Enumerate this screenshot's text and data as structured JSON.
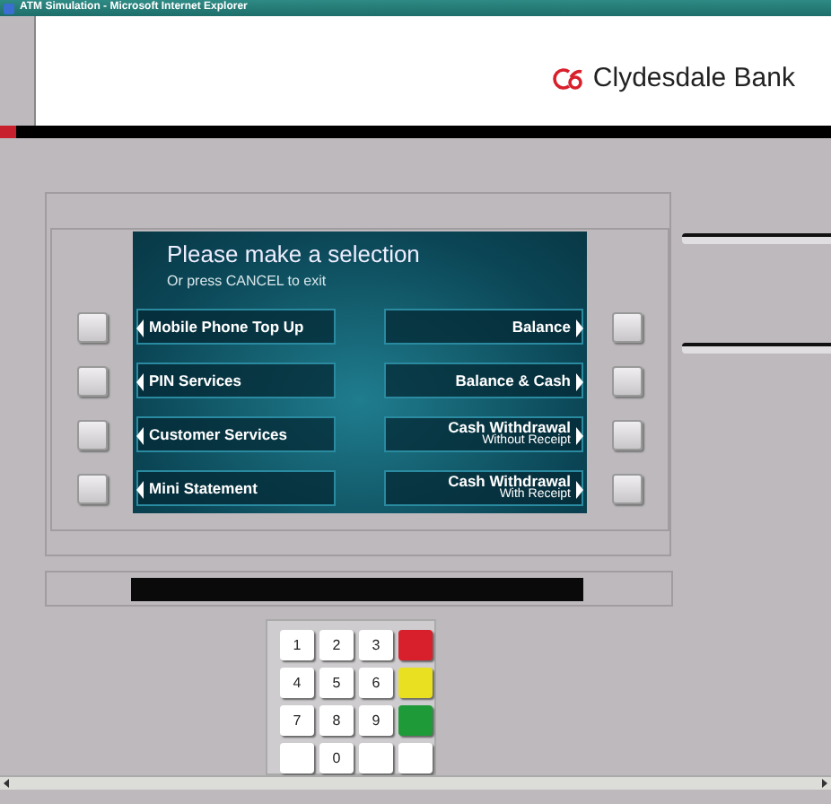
{
  "window": {
    "title": "ATM Simulation - Microsoft Internet Explorer"
  },
  "bank": {
    "name": "Clydesdale Bank"
  },
  "screen": {
    "heading": "Please make a selection",
    "subheading": "Or press CANCEL to exit",
    "left_options": [
      {
        "label": "Mobile Phone Top Up"
      },
      {
        "label": "PIN Services"
      },
      {
        "label": "Customer Services"
      },
      {
        "label": "Mini Statement"
      }
    ],
    "right_options": [
      {
        "label": "Balance"
      },
      {
        "label": "Balance & Cash"
      },
      {
        "label": "Cash Withdrawal",
        "sublabel": "Without Receipt"
      },
      {
        "label": "Cash Withdrawal",
        "sublabel": "With Receipt"
      }
    ]
  },
  "keypad": {
    "keys": [
      {
        "kind": "digit",
        "label": "1"
      },
      {
        "kind": "digit",
        "label": "2"
      },
      {
        "kind": "digit",
        "label": "3"
      },
      {
        "kind": "function",
        "color": "#d8202c"
      },
      {
        "kind": "digit",
        "label": "4"
      },
      {
        "kind": "digit",
        "label": "5"
      },
      {
        "kind": "digit",
        "label": "6"
      },
      {
        "kind": "function",
        "color": "#e8e020"
      },
      {
        "kind": "digit",
        "label": "7"
      },
      {
        "kind": "digit",
        "label": "8"
      },
      {
        "kind": "digit",
        "label": "9"
      },
      {
        "kind": "function",
        "color": "#1e9a38"
      },
      {
        "kind": "blank"
      },
      {
        "kind": "digit",
        "label": "0"
      },
      {
        "kind": "blank"
      },
      {
        "kind": "blank"
      }
    ]
  }
}
